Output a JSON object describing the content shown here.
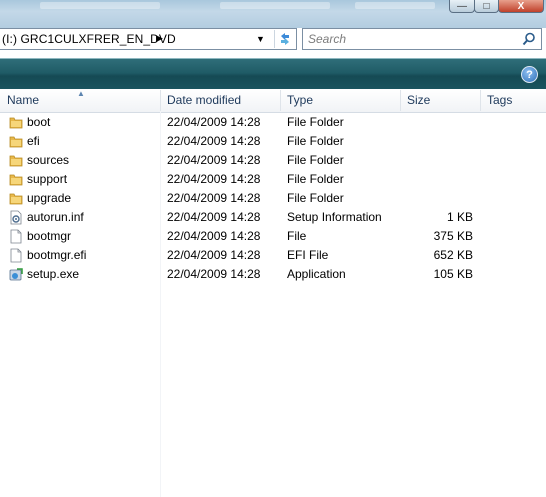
{
  "window": {
    "minimize_label": "—",
    "maximize_label": "□",
    "close_label": "X"
  },
  "address": {
    "path": "(I:) GRC1CULXFRER_EN_DVD",
    "separator": "▶",
    "dropdown": "▼"
  },
  "search": {
    "placeholder": "Search"
  },
  "help_label": "?",
  "columns": {
    "name": "Name",
    "date": "Date modified",
    "type": "Type",
    "size": "Size",
    "tags": "Tags"
  },
  "files": [
    {
      "name": "boot",
      "date": "22/04/2009 14:28",
      "type": "File Folder",
      "size": "",
      "icon": "folder-icon"
    },
    {
      "name": "efi",
      "date": "22/04/2009 14:28",
      "type": "File Folder",
      "size": "",
      "icon": "folder-icon"
    },
    {
      "name": "sources",
      "date": "22/04/2009 14:28",
      "type": "File Folder",
      "size": "",
      "icon": "folder-icon"
    },
    {
      "name": "support",
      "date": "22/04/2009 14:28",
      "type": "File Folder",
      "size": "",
      "icon": "folder-icon"
    },
    {
      "name": "upgrade",
      "date": "22/04/2009 14:28",
      "type": "File Folder",
      "size": "",
      "icon": "folder-icon"
    },
    {
      "name": "autorun.inf",
      "date": "22/04/2009 14:28",
      "type": "Setup Information",
      "size": "1 KB",
      "icon": "setup-info-icon"
    },
    {
      "name": "bootmgr",
      "date": "22/04/2009 14:28",
      "type": "File",
      "size": "375 KB",
      "icon": "file-icon"
    },
    {
      "name": "bootmgr.efi",
      "date": "22/04/2009 14:28",
      "type": "EFI File",
      "size": "652 KB",
      "icon": "file-icon"
    },
    {
      "name": "setup.exe",
      "date": "22/04/2009 14:28",
      "type": "Application",
      "size": "105 KB",
      "icon": "setup-exe-icon"
    }
  ],
  "colors": {
    "command_bar": "#1f5b66",
    "header_text": "#1e395b",
    "folder": "#e8b84a"
  }
}
